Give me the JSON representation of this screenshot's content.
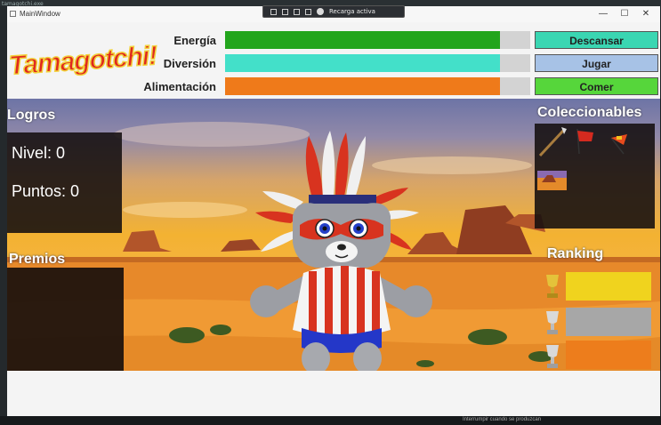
{
  "taskbar": {
    "process_text": "tamagotchi.exe"
  },
  "overlay": {
    "status_text": "Recarga activa"
  },
  "bottom_hint": "Interrumpir cuando se produzcan",
  "window": {
    "title": "MainWindow",
    "min": "—",
    "max": "☐",
    "close": "✕"
  },
  "logo": {
    "text": "Tamagotchi!"
  },
  "stats": [
    {
      "label": "Energía",
      "level": 0.9,
      "color": "#22a51c"
    },
    {
      "label": "Diversión",
      "level": 0.9,
      "color": "#43e0c9"
    },
    {
      "label": "Alimentación",
      "level": 0.9,
      "color": "#ef7a1a"
    }
  ],
  "actions": [
    {
      "label": "Descansar",
      "color": "#3ad6b2"
    },
    {
      "label": "Jugar",
      "color": "#a7c2e6"
    },
    {
      "label": "Comer",
      "color": "#56d63b"
    }
  ],
  "logros": {
    "title": "Logros",
    "nivel": "Nivel: 0",
    "puntos": "Puntos: 0"
  },
  "premios": {
    "title": "Premios"
  },
  "coleccionables": {
    "title": "Coleccionables"
  },
  "ranking": {
    "title": "Ranking",
    "colors": [
      "#f0d31e",
      "#a7a7a7",
      "#ed7d1c"
    ]
  },
  "icons": [
    "spear-icon",
    "flag-icon",
    "pennant-icon",
    "landscape-icon",
    "gold-trophy-icon",
    "silver-trophy-icon",
    "bronze-trophy-icon"
  ]
}
